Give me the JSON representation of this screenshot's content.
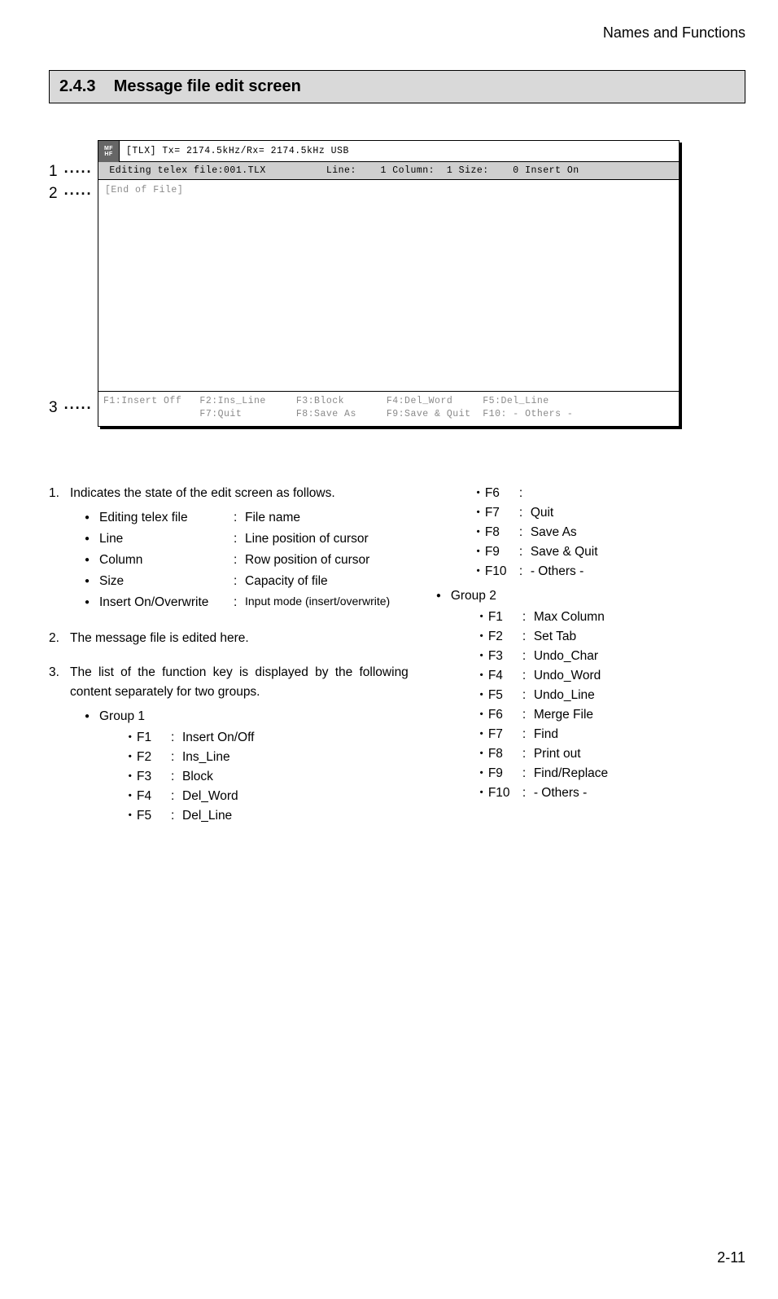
{
  "header": "Names and Functions",
  "section_number": "2.4.3",
  "section_title": "Message file edit screen",
  "callouts": {
    "c1": "1",
    "c2": "2",
    "c3": "3"
  },
  "screen": {
    "icon_top": "MF",
    "icon_bot": "HF",
    "top_text": "[TLX] Tx= 2174.5kHz/Rx= 2174.5kHz                     USB",
    "status": " Editing telex file:001.TLX          Line:    1 Column:  1 Size:    0 Insert On ",
    "body": "[End of File]",
    "fn1": "F1:Insert Off   F2:Ins_Line     F3:Block       F4:Del_Word     F5:Del_Line",
    "fn2": "                F7:Quit         F8:Save As     F9:Save & Quit  F10: - Others -"
  },
  "desc": {
    "item1_intro": "Indicates the state of the edit screen as follows.",
    "i1": [
      {
        "k": "Editing telex file",
        "v": "File name"
      },
      {
        "k": "Line",
        "v": "Line position of cursor"
      },
      {
        "k": "Column",
        "v": "Row position of cursor"
      },
      {
        "k": "Size",
        "v": "Capacity of file"
      },
      {
        "k": "Insert On/Overwrite",
        "v": "Input mode (insert/overwrite)"
      }
    ],
    "item2": "The message file is edited here.",
    "item3_intro": "The list of the function key is displayed by the following content separately for two groups.",
    "g1_label": "Group 1",
    "g2_label": "Group 2",
    "g1": [
      {
        "k": "F1",
        "v": "Insert On/Off"
      },
      {
        "k": "F2",
        "v": "Ins_Line"
      },
      {
        "k": "F3",
        "v": "Block"
      },
      {
        "k": "F4",
        "v": "Del_Word"
      },
      {
        "k": "F5",
        "v": "Del_Line"
      },
      {
        "k": "F6",
        "v": ""
      },
      {
        "k": "F7",
        "v": "Quit"
      },
      {
        "k": "F8",
        "v": "Save As"
      },
      {
        "k": "F9",
        "v": "Save & Quit"
      },
      {
        "k": "F10",
        "v": "- Others -"
      }
    ],
    "g2": [
      {
        "k": "F1",
        "v": "Max Column"
      },
      {
        "k": "F2",
        "v": "Set Tab"
      },
      {
        "k": "F3",
        "v": "Undo_Char"
      },
      {
        "k": "F4",
        "v": "Undo_Word"
      },
      {
        "k": "F5",
        "v": "Undo_Line"
      },
      {
        "k": "F6",
        "v": "Merge File"
      },
      {
        "k": "F7",
        "v": "Find"
      },
      {
        "k": "F8",
        "v": "Print out"
      },
      {
        "k": "F9",
        "v": "Find/Replace"
      },
      {
        "k": "F10",
        "v": "- Others -"
      }
    ]
  },
  "page_number": "2-11"
}
